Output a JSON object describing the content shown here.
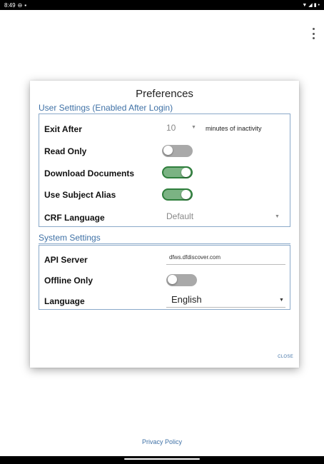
{
  "status_bar": {
    "time": "8:49"
  },
  "dialog": {
    "title": "Preferences",
    "close_label": "CLOSE",
    "user_settings": {
      "header": "User Settings (Enabled After Login)",
      "exit_after": {
        "label": "Exit After",
        "value": "10",
        "suffix": "minutes of inactivity"
      },
      "read_only": {
        "label": "Read Only",
        "enabled": false
      },
      "download_documents": {
        "label": "Download Documents",
        "enabled": true
      },
      "use_subject_alias": {
        "label": "Use Subject Alias",
        "enabled": true
      },
      "crf_language": {
        "label": "CRF Language",
        "value": "Default"
      }
    },
    "system_settings": {
      "header": "System Settings",
      "api_server": {
        "label": "API Server",
        "value": "dfws.dfdiscover.com"
      },
      "offline_only": {
        "label": "Offline Only",
        "enabled": false
      },
      "language": {
        "label": "Language",
        "value": "English"
      }
    }
  },
  "footer": {
    "privacy_link": "Privacy Policy"
  },
  "colors": {
    "accent": "#3f71a6",
    "toggle_on": "#2f7f3d",
    "toggle_off": "#a9a9a9"
  }
}
